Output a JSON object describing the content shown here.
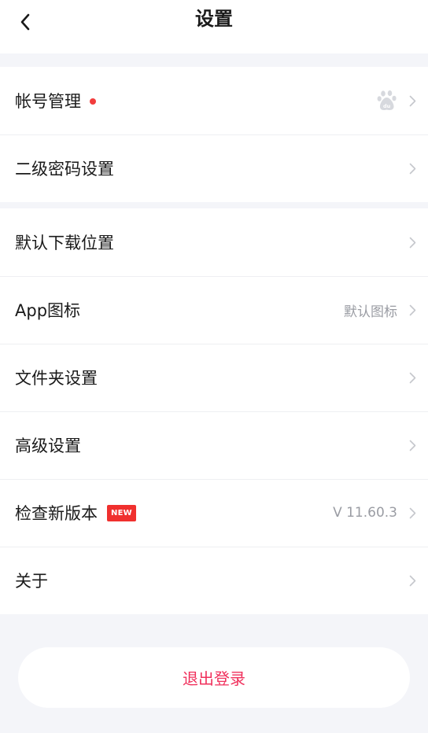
{
  "header": {
    "title": "设置"
  },
  "group1": [
    {
      "label": "帐号管理",
      "value": ""
    },
    {
      "label": "二级密码设置",
      "value": ""
    }
  ],
  "group2": [
    {
      "label": "默认下载位置",
      "value": ""
    },
    {
      "label": "App图标",
      "value": "默认图标"
    },
    {
      "label": "文件夹设置",
      "value": ""
    },
    {
      "label": "高级设置",
      "value": ""
    },
    {
      "label": "检查新版本",
      "badge": "NEW",
      "value": "V 11.60.3"
    },
    {
      "label": "关于",
      "value": ""
    }
  ],
  "logout_label": "退出登录",
  "colors": {
    "accent": "#f0305c",
    "badge": "#f0302e",
    "dot": "#f23d3d",
    "background": "#f4f5f9"
  },
  "icons": {
    "back": "chevron-left-icon",
    "account_avatar": "baidu-paw-icon",
    "row_arrow": "chevron-right-icon"
  }
}
